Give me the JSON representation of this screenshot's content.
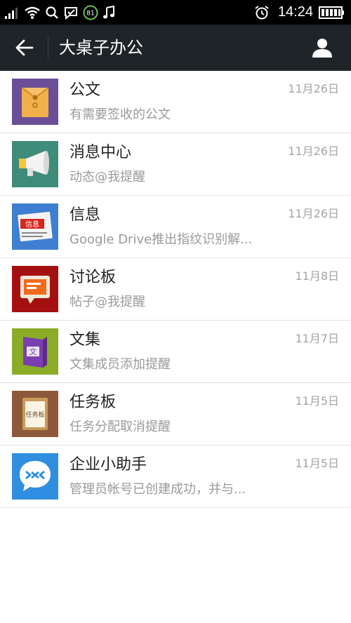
{
  "status_bar": {
    "time": "14:24",
    "notification_badge": "81",
    "icons": [
      "signal-icon",
      "wifi-icon",
      "search-icon",
      "message-icon",
      "badge-icon",
      "music-icon",
      "alarm-icon",
      "battery-icon"
    ]
  },
  "action_bar": {
    "title": "大桌子办公",
    "background": "#1e2427"
  },
  "items": [
    {
      "title": "公文",
      "subtitle": "有需要签收的公文",
      "date": "11月26日",
      "icon": "envelope-icon",
      "color": "#6a4f98"
    },
    {
      "title": "消息中心",
      "subtitle": "动态@我提醒",
      "date": "11月26日",
      "icon": "megaphone-icon",
      "color": "#3f8c7a"
    },
    {
      "title": "信息",
      "subtitle": "Google Drive推出指纹识别解...",
      "date": "11月26日",
      "icon": "newspaper-icon",
      "color": "#3f7fd1"
    },
    {
      "title": "讨论板",
      "subtitle": "帖子@我提醒",
      "date": "11月8日",
      "icon": "chat-board-icon",
      "color": "#a4100f"
    },
    {
      "title": "文集",
      "subtitle": "文集成员添加提醒",
      "date": "11月7日",
      "icon": "book-icon",
      "color": "#8aac26"
    },
    {
      "title": "任务板",
      "subtitle": "任务分配取消提醒",
      "date": "11月5日",
      "icon": "task-board-icon",
      "color": "#8c5a3a",
      "icon_text": "任务板"
    },
    {
      "title": "企业小助手",
      "subtitle": "管理员帐号已创建成功，并与...",
      "date": "11月5日",
      "icon": "assistant-icon",
      "color": "#2f8ee0"
    }
  ]
}
